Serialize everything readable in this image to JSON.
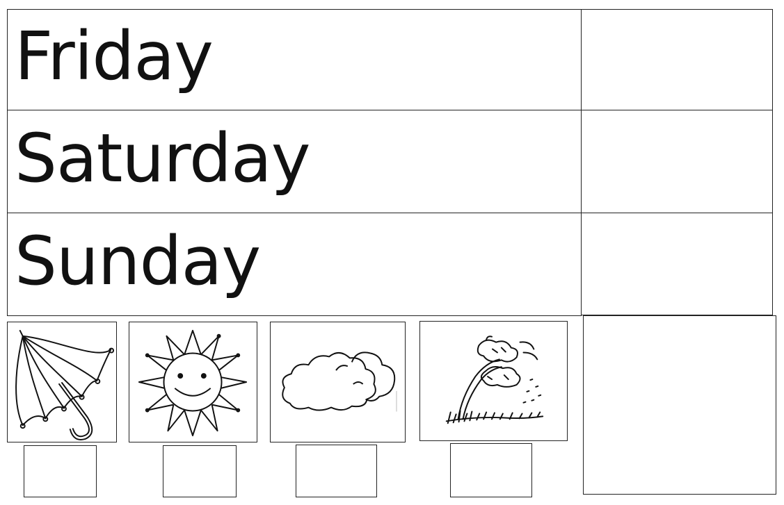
{
  "worksheet": {
    "days": [
      {
        "label": "Friday"
      },
      {
        "label": "Saturday"
      },
      {
        "label": "Sunday"
      }
    ],
    "weather_pictures": [
      {
        "icon": "umbrella-icon"
      },
      {
        "icon": "sun-icon"
      },
      {
        "icon": "cloud-icon"
      },
      {
        "icon": "windy-tree-icon"
      }
    ]
  }
}
